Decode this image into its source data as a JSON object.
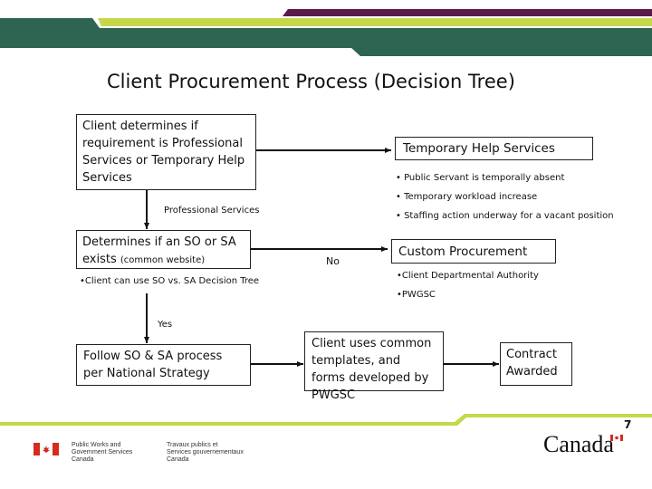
{
  "slide": {
    "title": "Client Procurement Process (Decision Tree)",
    "page_number": "7"
  },
  "colors": {
    "banner_green": "#2d6452",
    "banner_lime": "#c4d84a",
    "banner_purple": "#5a1a4a",
    "line": "#111111"
  },
  "nodes": {
    "start": {
      "text": "Client determines if requirement is Professional Services or Temporary Help Services"
    },
    "temp_help": {
      "text": "Temporary Help Services",
      "bullets": [
        "• Public Servant is temporally absent",
        "• Temporary workload increase",
        "• Staffing action underway for a vacant position"
      ]
    },
    "so_sa": {
      "text_main": "Determines if an SO or SA exists",
      "text_note": "(common website)",
      "bullets": [
        "•Client can use SO vs. SA Decision Tree"
      ]
    },
    "custom": {
      "text": "Custom Procurement",
      "bullets": [
        "•Client Departmental Authority",
        "•PWGSC"
      ]
    },
    "follow": {
      "text": "Follow SO & SA process per National Strategy"
    },
    "templates": {
      "text": "Client uses common templates, and forms developed by PWGSC"
    },
    "awarded": {
      "text": "Contract Awarded"
    }
  },
  "edges": {
    "professional_services_label": "Professional Services",
    "no_label": "No",
    "yes_label": "Yes"
  },
  "footer": {
    "dept_en": [
      "Public Works and",
      "Government Services",
      "Canada"
    ],
    "dept_fr": [
      "Travaux publics et",
      "Services gouvernementaux",
      "Canada"
    ],
    "wordmark": "Canada",
    "icons": {
      "flag": "canada-flag-icon",
      "wordmark": "canada-wordmark"
    }
  }
}
